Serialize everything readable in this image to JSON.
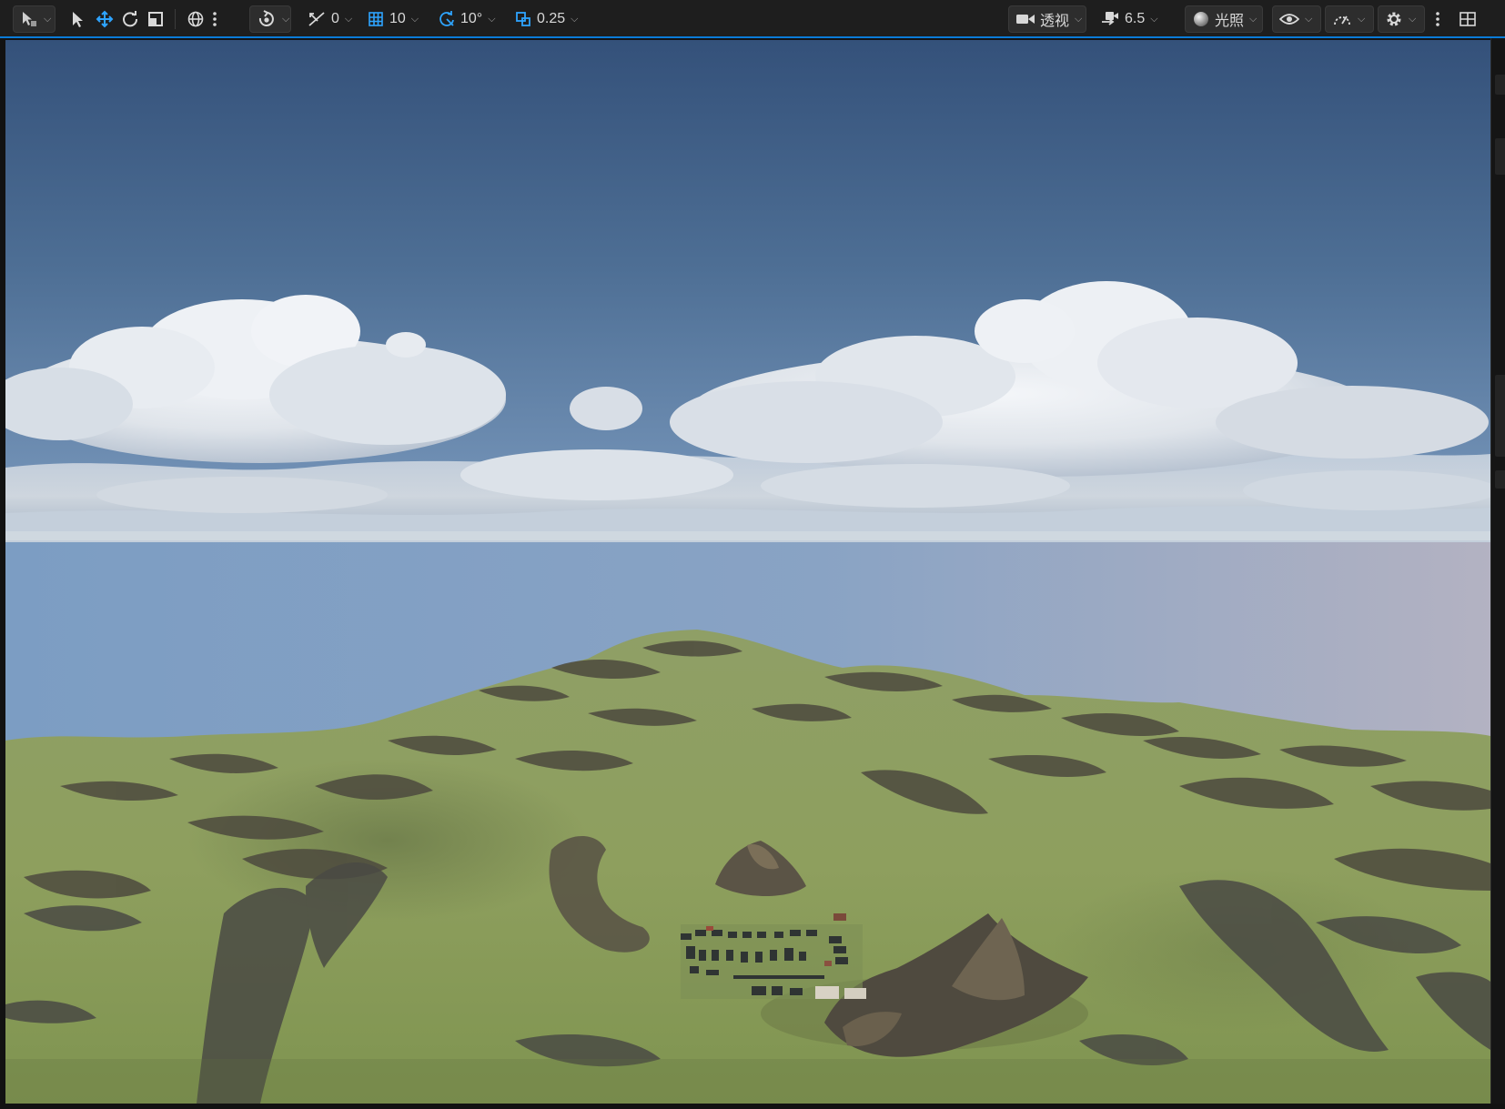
{
  "window": {
    "title": ""
  },
  "toolbar": {
    "select_mode": {
      "icon": "select-mode-icon"
    },
    "transform_tools": [
      {
        "icon": "cursor-arrow-icon",
        "active": false
      },
      {
        "icon": "translate-arrows-icon",
        "active": true
      },
      {
        "icon": "rotate-icon",
        "active": false
      },
      {
        "icon": "scale-icon",
        "active": false
      }
    ],
    "coordinate_space": {
      "icon": "globe-icon"
    },
    "more_icon": "vertical-dots-icon",
    "snap_surface": {
      "icon": "surface-snap-icon"
    },
    "surface_snap_value": "0",
    "grid_snap_value": "10",
    "rotation_snap_value": "10°",
    "scale_snap_value": "0.25",
    "view_mode_label": "透视",
    "camera_speed_value": "6.5",
    "lighting_label": "光照",
    "show_icon": "eye-icon",
    "performance_icon": "speedometer-icon",
    "settings_icon": "gear-icon",
    "layout_icon": "viewport-layout-icon",
    "accent_color": "#0a7bd8"
  },
  "viewport": {
    "scene": "landscape-with-sky-and-clouds"
  }
}
